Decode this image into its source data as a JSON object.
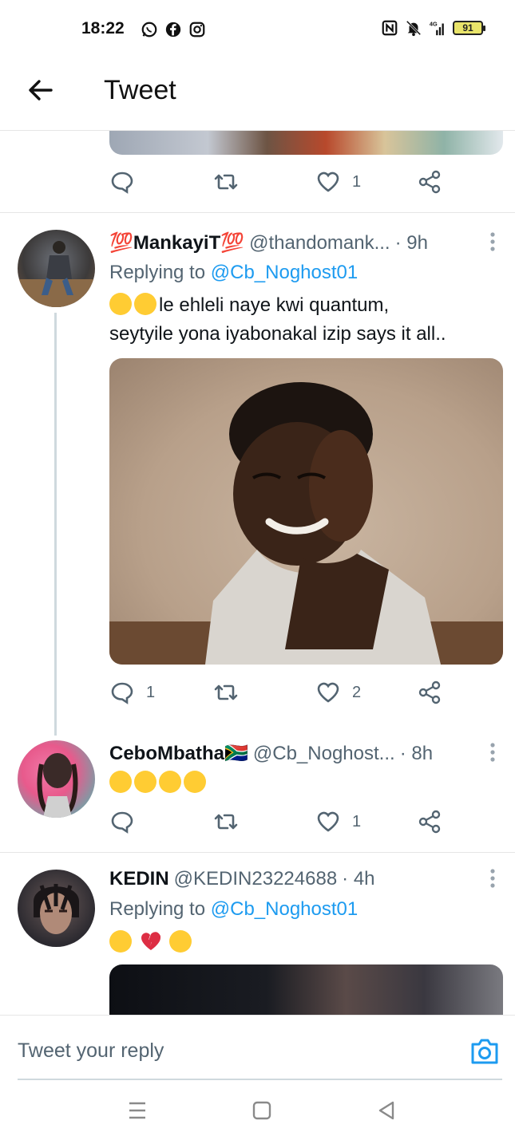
{
  "status_bar": {
    "time": "18:22",
    "network": "4G",
    "battery": "91",
    "left_icons": [
      "whatsapp-icon",
      "facebook-icon",
      "instagram-icon"
    ],
    "right_icons": [
      "nfc-icon",
      "bell-muted-icon",
      "signal-icon",
      "battery-icon"
    ]
  },
  "header": {
    "title": "Tweet",
    "back_icon": "arrow-left-icon"
  },
  "top_tweet": {
    "like_count": "1"
  },
  "tweets": [
    {
      "name": "💯MankayiT💯",
      "handle": "@thandomank...",
      "time": "· 9h",
      "replying_label": "Replying to",
      "replying_to": "@Cb_Noghost01",
      "text_line1": "le ehleli naye kwi quantum,",
      "text_line2": "seytyile yona iyabonakal izip says it all..",
      "reply_count": "1",
      "like_count": "2"
    },
    {
      "name": "CeboMbatha🇿🇦",
      "handle": "@Cb_Noghost...",
      "time": "· 8h",
      "like_count": "1"
    },
    {
      "name": "KEDIN",
      "handle": "@KEDIN23224688",
      "time": "· 4h",
      "replying_label": "Replying to",
      "replying_to": "@Cb_Noghost01"
    }
  ],
  "reply_bar": {
    "placeholder": "Tweet your reply",
    "camera_icon": "camera-icon"
  },
  "nav": {
    "buttons": [
      "menu-icon",
      "home-square-icon",
      "back-triangle-icon"
    ]
  },
  "colors": {
    "link": "#1d9bf0",
    "secondary": "#536471",
    "text": "#0f1419"
  }
}
